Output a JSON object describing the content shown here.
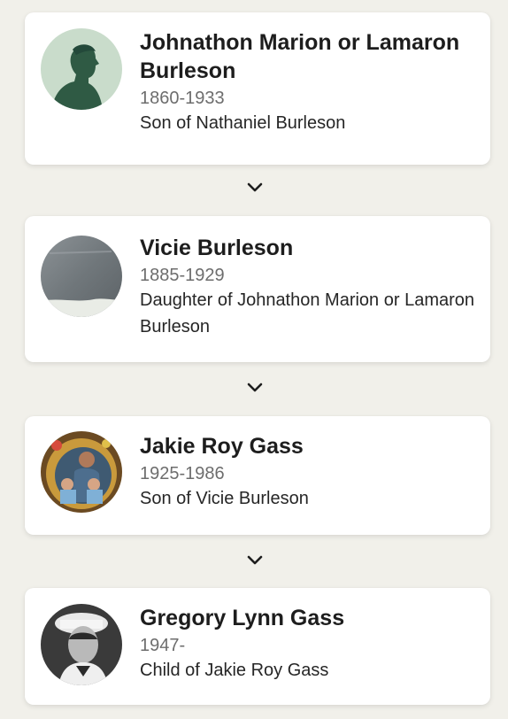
{
  "people": [
    {
      "name": "Johnathon Marion or Lamaron Burleson",
      "years": "1860-1933",
      "relation": "Son of Nathaniel Burleson",
      "avatar_icon": "silhouette-placeholder"
    },
    {
      "name": "Vicie Burleson",
      "years": "1885-1929",
      "relation": "Daughter of Johnathon Marion or Lamaron Burleson",
      "avatar_icon": "gravestone-photo"
    },
    {
      "name": "Jakie Roy Gass",
      "years": "1925-1986",
      "relation": "Son of Vicie Burleson",
      "avatar_icon": "family-photo"
    },
    {
      "name": "Gregory Lynn Gass",
      "years": "1947-",
      "relation": "Child of Jakie Roy Gass",
      "avatar_icon": "portrait-photo"
    }
  ],
  "colors": {
    "background": "#f1f0ea",
    "card": "#ffffff",
    "name_text": "#1d1d1d",
    "years_text": "#6d6d6d",
    "silhouette_bg": "#c9dccb",
    "silhouette_fg": "#2f5a44"
  }
}
